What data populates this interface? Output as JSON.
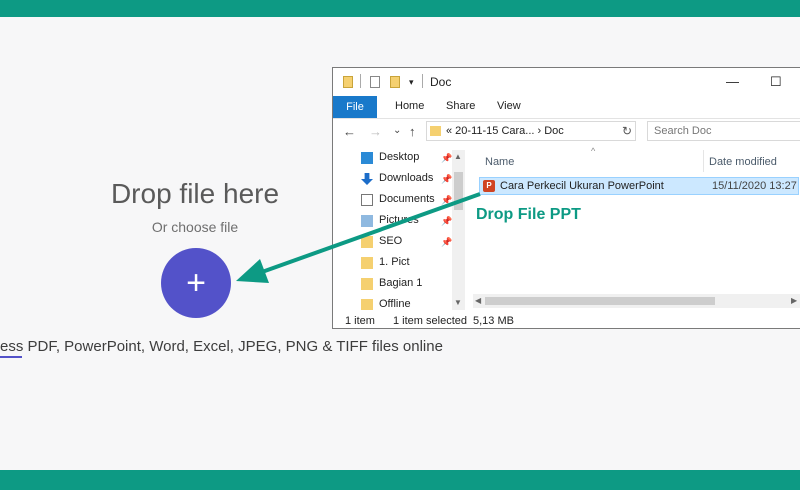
{
  "uploader": {
    "title": "Drop file here",
    "subtitle": "Or choose file",
    "add_symbol": "+",
    "compress_text": "ess PDF, PowerPoint, Word, Excel, JPEG, PNG & TIFF files online"
  },
  "explorer": {
    "title": "Doc",
    "window_buttons": {
      "minimize": "—",
      "maximize": "☐"
    },
    "ribbon_tabs": [
      "File",
      "Home",
      "Share",
      "View"
    ],
    "nav_buttons": {
      "back": "←",
      "forward": "→",
      "recent": "⌄",
      "up": "↑"
    },
    "address": "« 20-11-15 Cara...  ›  Doc",
    "refresh": "↻",
    "search_placeholder": "Search Doc",
    "nav_items": [
      {
        "label": "Desktop",
        "pinned": true
      },
      {
        "label": "Downloads",
        "pinned": true
      },
      {
        "label": "Documents",
        "pinned": true
      },
      {
        "label": "Pictures",
        "pinned": true
      },
      {
        "label": "SEO",
        "pinned": true
      },
      {
        "label": "1. Pict",
        "pinned": false
      },
      {
        "label": "Bagian 1",
        "pinned": false
      },
      {
        "label": "Offline",
        "pinned": false
      }
    ],
    "columns": {
      "name": "Name",
      "date": "Date modified"
    },
    "file": {
      "icon_letter": "P",
      "name": "Cara Perkecil Ukuran PowerPoint",
      "date": "15/11/2020 13:27"
    },
    "status": {
      "count": "1 item",
      "selected": "1 item selected",
      "size": "5,13 MB"
    }
  },
  "annotation": {
    "label": "Drop File PPT"
  },
  "colors": {
    "teal": "#0d9a84",
    "button": "#5352c9",
    "file_blue": "#1979ca"
  }
}
